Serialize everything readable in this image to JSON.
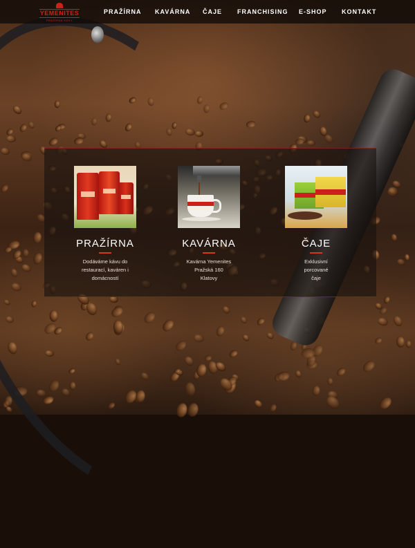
{
  "brand": {
    "name": "YEMENITES",
    "tagline": "PRAŽÍRNA KÁVY",
    "accent_color": "#c8221a",
    "rule_color": "#d9361f"
  },
  "nav": {
    "items": [
      {
        "label": "PRAŽÍRNA"
      },
      {
        "label": "KAVÁRNA"
      },
      {
        "label": "ČAJE"
      },
      {
        "label": "FRANCHISING"
      },
      {
        "label": "E-SHOP"
      },
      {
        "label": "KONTAKT"
      }
    ]
  },
  "cards": [
    {
      "title": "PRAŽÍRNA",
      "text": "Dodáváme kávu do\nrestaurací, kaváren i\ndomácností",
      "image": "coffee-bags"
    },
    {
      "title": "KAVÁRNA",
      "text": "Kavárna Yemenites\nPražská 160\nKlatovy",
      "image": "espresso-cup"
    },
    {
      "title": "ČAJE",
      "text": "Exklusivní\nporcované\nčaje",
      "image": "tea-boxes"
    }
  ],
  "background": {
    "image": "coffee-roaster-beans"
  }
}
